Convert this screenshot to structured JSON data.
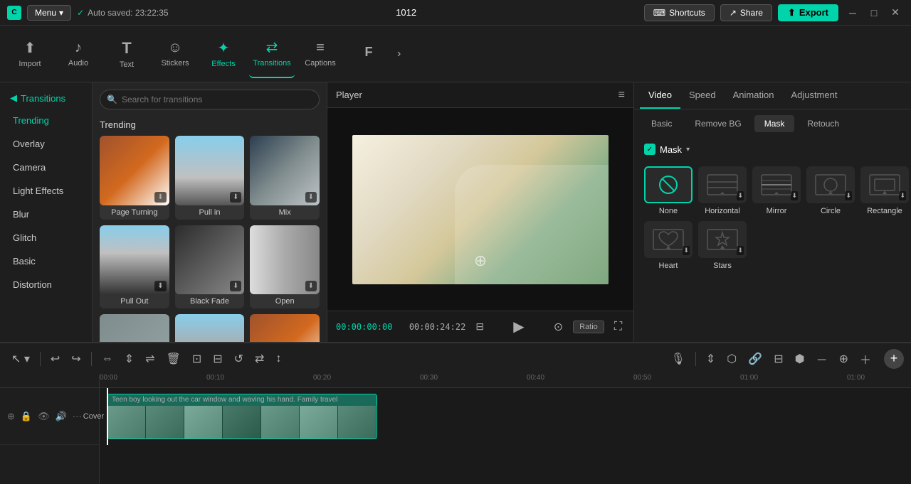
{
  "app": {
    "logo": "C",
    "menu_label": "Menu",
    "auto_saved": "Auto saved: 23:22:35",
    "project_id": "1012",
    "shortcuts_label": "Shortcuts",
    "share_label": "Share",
    "export_label": "Export"
  },
  "toolbar": {
    "items": [
      {
        "id": "import",
        "icon": "⬆",
        "label": "Import"
      },
      {
        "id": "audio",
        "icon": "♪",
        "label": "Audio"
      },
      {
        "id": "text",
        "icon": "T",
        "label": "Text"
      },
      {
        "id": "stickers",
        "icon": "☺",
        "label": "Stickers"
      },
      {
        "id": "effects",
        "icon": "✦",
        "label": "Effects"
      },
      {
        "id": "transitions",
        "icon": "⇄",
        "label": "Transitions"
      },
      {
        "id": "captions",
        "icon": "≡",
        "label": "Captions"
      },
      {
        "id": "more",
        "icon": "F",
        "label": "F"
      }
    ],
    "more_icon": "›"
  },
  "left_panel": {
    "header": "Transitions",
    "items": [
      {
        "id": "trending",
        "label": "Trending",
        "active": true
      },
      {
        "id": "overlay",
        "label": "Overlay"
      },
      {
        "id": "camera",
        "label": "Camera"
      },
      {
        "id": "light_effects",
        "label": "Light Effects"
      },
      {
        "id": "blur",
        "label": "Blur"
      },
      {
        "id": "glitch",
        "label": "Glitch"
      },
      {
        "id": "basic",
        "label": "Basic"
      },
      {
        "id": "distortion",
        "label": "Distortion"
      }
    ]
  },
  "transitions_panel": {
    "search_placeholder": "Search for transitions",
    "section_title": "Trending",
    "items": [
      {
        "id": "page_turning",
        "label": "Page Turning",
        "has_download": true
      },
      {
        "id": "pull_in",
        "label": "Pull in",
        "has_download": true
      },
      {
        "id": "mix",
        "label": "Mix",
        "has_download": true
      },
      {
        "id": "pull_out",
        "label": "Pull Out",
        "has_download": true
      },
      {
        "id": "black_fade",
        "label": "Black Fade",
        "has_download": true
      },
      {
        "id": "open",
        "label": "Open",
        "has_download": true
      },
      {
        "id": "more_1",
        "label": "",
        "has_download": false
      },
      {
        "id": "more_2",
        "label": "",
        "has_download": false
      },
      {
        "id": "more_3",
        "label": "",
        "has_download": false
      }
    ]
  },
  "player": {
    "title": "Player",
    "time_current": "00:00:00:00",
    "time_total": "00:00:24:22"
  },
  "right_panel": {
    "tabs": [
      {
        "id": "video",
        "label": "Video",
        "active": true
      },
      {
        "id": "speed",
        "label": "Speed"
      },
      {
        "id": "animation",
        "label": "Animation"
      },
      {
        "id": "adjustment",
        "label": "Adjustment"
      }
    ],
    "sub_tabs": [
      {
        "id": "basic",
        "label": "Basic"
      },
      {
        "id": "remove_bg",
        "label": "Remove BG"
      },
      {
        "id": "mask",
        "label": "Mask",
        "active": true
      },
      {
        "id": "retouch",
        "label": "Retouch"
      }
    ],
    "mask_section": {
      "label": "Mask",
      "items": [
        {
          "id": "none",
          "label": "None",
          "selected": true,
          "shape": "none"
        },
        {
          "id": "horizontal",
          "label": "Horizontal",
          "shape": "horizontal"
        },
        {
          "id": "mirror",
          "label": "Mirror",
          "shape": "mirror"
        },
        {
          "id": "circle",
          "label": "Circle",
          "shape": "circle"
        },
        {
          "id": "rectangle",
          "label": "Rectangle",
          "shape": "rectangle"
        },
        {
          "id": "heart",
          "label": "Heart",
          "shape": "heart"
        },
        {
          "id": "stars",
          "label": "Stars",
          "shape": "stars"
        }
      ]
    }
  },
  "timeline": {
    "ruler_marks": [
      "00:00",
      "00:10",
      "00:20",
      "00:30",
      "00:40",
      "00:50",
      "01:00",
      "01:00"
    ],
    "clip_title": "Teen boy looking out the car window and waving his hand. Family travel",
    "cover_label": "Cover"
  },
  "tl_toolbar": {
    "buttons": [
      "↕",
      "↩",
      "↪",
      "⇔",
      "⇕",
      "⇌",
      "⊡",
      "⊟",
      "⊞",
      "⊛",
      "⊜",
      "⊝"
    ],
    "right_buttons": [
      "🎙",
      "⬡",
      "⬢",
      "⬣",
      "⬤",
      "⬥",
      "⬦",
      "⊕",
      "⊖",
      "➕"
    ]
  }
}
